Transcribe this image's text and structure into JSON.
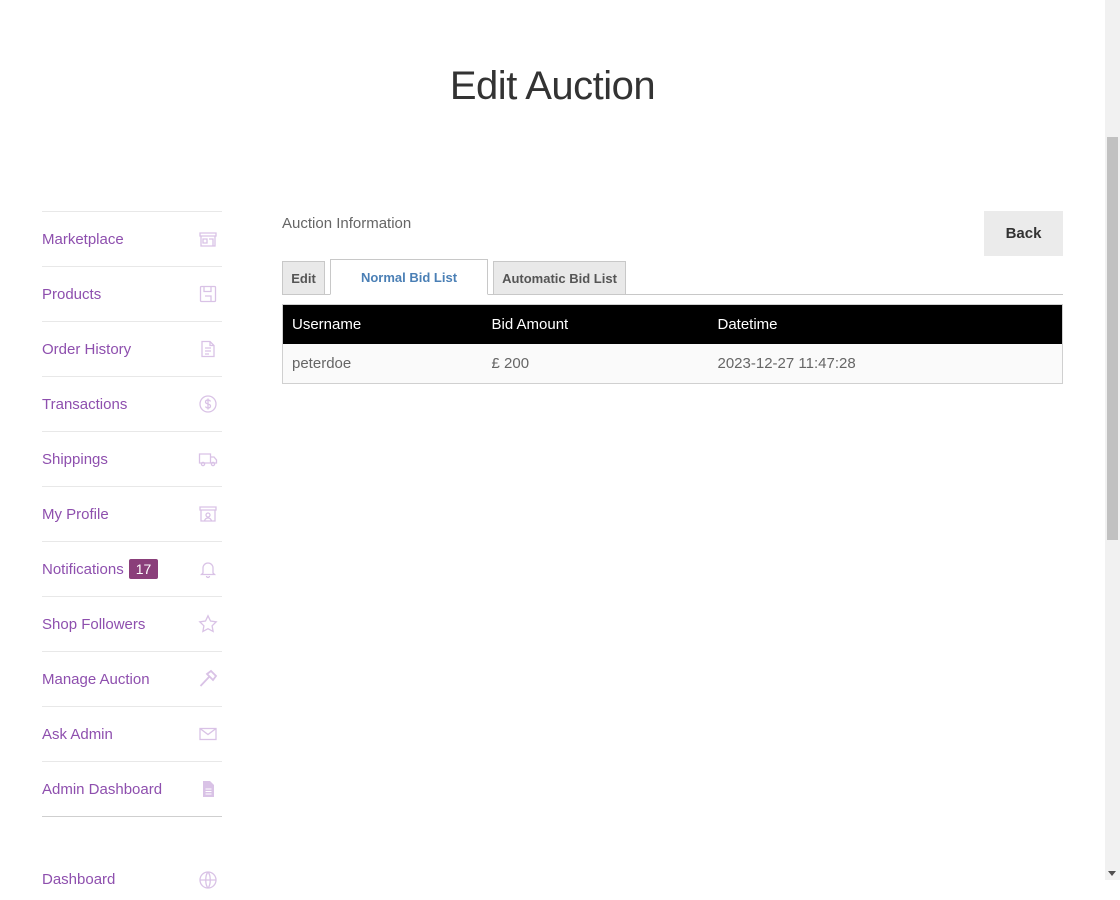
{
  "page": {
    "title": "Edit Auction"
  },
  "sidebar": {
    "items": [
      {
        "label": "Marketplace",
        "icon": "storefront-icon"
      },
      {
        "label": "Products",
        "icon": "floppy-icon"
      },
      {
        "label": "Order History",
        "icon": "document-icon"
      },
      {
        "label": "Transactions",
        "icon": "dollar-icon"
      },
      {
        "label": "Shippings",
        "icon": "truck-icon"
      },
      {
        "label": "My Profile",
        "icon": "profile-icon"
      },
      {
        "label": "Notifications",
        "badge": "17",
        "icon": "bell-icon"
      },
      {
        "label": "Shop Followers",
        "icon": "star-icon"
      },
      {
        "label": "Manage Auction",
        "icon": "hammer-icon"
      },
      {
        "label": "Ask Admin",
        "icon": "envelope-icon"
      },
      {
        "label": "Admin Dashboard",
        "icon": "file-icon"
      }
    ],
    "extra": {
      "label": "Dashboard",
      "icon": "globe-icon"
    },
    "icon_color": "#d9c2e6",
    "link_color": "#8e4fae"
  },
  "main": {
    "section_label": "Auction Information",
    "back_label": "Back",
    "tabs": [
      {
        "label": "Edit"
      },
      {
        "label": "Normal Bid List",
        "active": true
      },
      {
        "label": "Automatic Bid List"
      }
    ],
    "table": {
      "headers": [
        "Username",
        "Bid Amount",
        "Datetime"
      ],
      "rows": [
        [
          "peterdoe",
          "£ 200",
          "2023-12-27 11:47:28"
        ]
      ]
    }
  }
}
